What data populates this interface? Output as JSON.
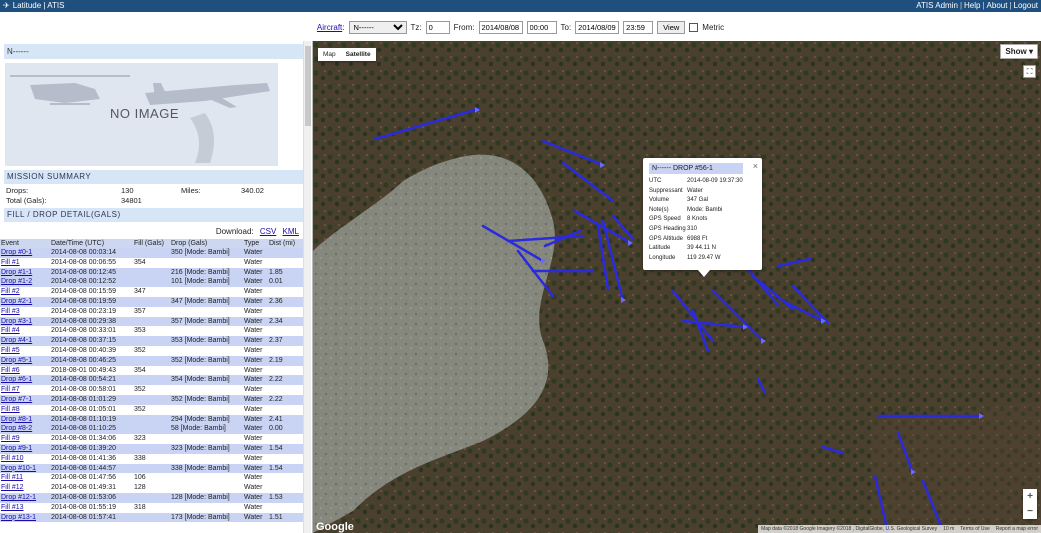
{
  "topbar": {
    "brand": "Latitude | ATIS",
    "links": [
      "ATIS Admin",
      "Help",
      "About",
      "Logout"
    ],
    "sep": "|"
  },
  "filter": {
    "aircraft_label": "Aircraft",
    "aircraft_colon": ":",
    "aircraft_value": "N------",
    "tz_label": "Tz:",
    "tz_value": "0",
    "from_label": "From:",
    "from_date": "2014/08/08",
    "from_time": "00:00",
    "to_label": "To:",
    "to_date": "2014/08/09",
    "to_time": "23:59",
    "view_label": "View",
    "metric_label": "Metric"
  },
  "panel": {
    "title": "N------",
    "noimage": "NO IMAGE"
  },
  "summary": {
    "heading": "MISSION SUMMARY",
    "drops_label": "Drops:",
    "drops_value": "130",
    "miles_label": "Miles:",
    "miles_value": "340.02",
    "total_label": "Total (Gals):",
    "total_value": "34801"
  },
  "detail": {
    "heading": "FILL / DROP DETAIL(GALS)",
    "download_label": "Download:",
    "csv": "CSV",
    "kml": "KML"
  },
  "table": {
    "headers": [
      "Event",
      "Date/Time (UTC)",
      "Fill (Gals)",
      "Drop (Gals)",
      "Type",
      "Dist (mi)"
    ],
    "rows": [
      [
        "Drop #0-1",
        "2014-08-08 00:03:14",
        "",
        "350 [Mode: Bambi]",
        "Water",
        ""
      ],
      [
        "Fill #1",
        "2014-08-08 00:06:55",
        "354",
        "",
        "Water",
        ""
      ],
      [
        "Drop #1-1",
        "2014-08-08 00:12:45",
        "",
        "216 [Mode: Bambi]",
        "Water",
        "1.85"
      ],
      [
        "Drop #1-2",
        "2014-08-08 00:12:52",
        "",
        "101 [Mode: Bambi]",
        "Water",
        "0.01"
      ],
      [
        "Fill #2",
        "2014-08-08 00:15:59",
        "347",
        "",
        "Water",
        ""
      ],
      [
        "Drop #2-1",
        "2014-08-08 00:19:59",
        "",
        "347 [Mode: Bambi]",
        "Water",
        "2.36"
      ],
      [
        "Fill #3",
        "2014-08-08 00:23:19",
        "357",
        "",
        "Water",
        ""
      ],
      [
        "Drop #3-1",
        "2014-08-08 00:29:38",
        "",
        "357 [Mode: Bambi]",
        "Water",
        "2.34"
      ],
      [
        "Fill #4",
        "2014-08-08 00:33:01",
        "353",
        "",
        "Water",
        ""
      ],
      [
        "Drop #4-1",
        "2014-08-08 00:37:15",
        "",
        "353 [Mode: Bambi]",
        "Water",
        "2.37"
      ],
      [
        "Fill #5",
        "2014-08-08 00:40:39",
        "352",
        "",
        "Water",
        ""
      ],
      [
        "Drop #5-1",
        "2014-08-08 00:46:25",
        "",
        "352 [Mode: Bambi]",
        "Water",
        "2.19"
      ],
      [
        "Fill #6",
        "2018-08-01 00:49:43",
        "354",
        "",
        "Water",
        ""
      ],
      [
        "Drop #6-1",
        "2014-08-08 00:54:21",
        "",
        "354 [Mode: Bambi]",
        "Water",
        "2.22"
      ],
      [
        "Fill #7",
        "2014-08-08 00:58:01",
        "352",
        "",
        "Water",
        ""
      ],
      [
        "Drop #7-1",
        "2014-08-08 01:01:29",
        "",
        "352 [Mode: Bambi]",
        "Water",
        "2.22"
      ],
      [
        "Fill #8",
        "2014-08-08 01:05:01",
        "352",
        "",
        "Water",
        ""
      ],
      [
        "Drop #8-1",
        "2014-08-08 01:10:19",
        "",
        "294 [Mode: Bambi]",
        "Water",
        "2.41"
      ],
      [
        "Drop #8-2",
        "2014-08-08 01:10:25",
        "",
        "58 [Mode: Bambi]",
        "Water",
        "0.00"
      ],
      [
        "Fill #9",
        "2014-08-08 01:34:06",
        "323",
        "",
        "Water",
        ""
      ],
      [
        "Drop #9-1",
        "2014-08-08 01:39:20",
        "",
        "323 [Mode: Bambi]",
        "Water",
        "1.54"
      ],
      [
        "Fill #10",
        "2014-08-08 01:41:36",
        "338",
        "",
        "Water",
        ""
      ],
      [
        "Drop #10-1",
        "2014-08-08 01:44:57",
        "",
        "338 [Mode: Bambi]",
        "Water",
        "1.54"
      ],
      [
        "Fill #11",
        "2014-08-08 01:47:56",
        "106",
        "",
        "Water",
        ""
      ],
      [
        "Fill #12",
        "2014-08-08 01:49:31",
        "128",
        "",
        "Water",
        ""
      ],
      [
        "Drop #12-1",
        "2014-08-08 01:53:06",
        "",
        "128 [Mode: Bambi]",
        "Water",
        "1.53"
      ],
      [
        "Fill #13",
        "2014-08-08 01:55:19",
        "318",
        "",
        "Water",
        ""
      ],
      [
        "Drop #13-1",
        "2014-08-08 01:57:41",
        "",
        "173 [Mode: Bambi]",
        "Water",
        "1.51"
      ]
    ]
  },
  "map": {
    "tab_map": "Map",
    "tab_satellite": "Satellite",
    "show_label": "Show ▾",
    "zoom_in": "+",
    "zoom_out": "−",
    "google": "Google",
    "attribution": [
      "Map data ©2018 Google Imagery ©2018 , DigitalGlobe, U.S. Geological Survey",
      "10 m",
      "Terms of Use",
      "Report a map error"
    ]
  },
  "infowindow": {
    "title": "N------  DROP #56-1",
    "fields": [
      [
        "UTC",
        "2014-08-09 19:37:30"
      ],
      [
        "Suppressant",
        "Water"
      ],
      [
        "Volume",
        "347 Gal"
      ],
      [
        "Note(s)",
        "Mode: Bambi"
      ],
      [
        "GPS Speed",
        "8 Knots"
      ],
      [
        "GPS Heading",
        "310"
      ],
      [
        "GPS Altitude",
        "6988 Ft"
      ],
      [
        "Latitude",
        "39 44.11 N"
      ],
      [
        "Longitude",
        "119 29.47 W"
      ]
    ]
  },
  "colors": {
    "topbar": "#1f4f7e",
    "section": "#d6e6f7",
    "drop_row": "#c9d3f3",
    "track": "#2a2adf"
  }
}
